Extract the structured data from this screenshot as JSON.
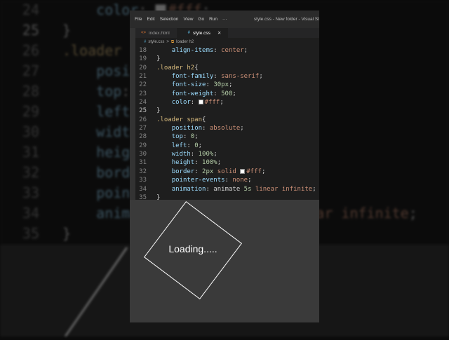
{
  "menu": [
    "File",
    "Edit",
    "Selection",
    "View",
    "Go",
    "Run",
    "···"
  ],
  "window_title": "style.css - New folder - Visual St",
  "tabs": [
    {
      "label": "index.html",
      "icon": "<>"
    },
    {
      "label": "style.css",
      "icon": "#",
      "close": "✕"
    }
  ],
  "breadcrumb": {
    "file": "style.css",
    "sep": ">",
    "symbol": "loader h2"
  },
  "code_lines": [
    {
      "n": "18",
      "parts": [
        [
          "t",
          "    "
        ],
        [
          "p",
          "align-items"
        ],
        [
          "t",
          ": "
        ],
        [
          "v",
          "center"
        ],
        [
          "t",
          ";"
        ]
      ]
    },
    {
      "n": "19",
      "parts": [
        [
          "t",
          "}"
        ]
      ]
    },
    {
      "n": "20",
      "parts": [
        [
          "s",
          ".loader h2"
        ],
        [
          "t",
          "{"
        ]
      ]
    },
    {
      "n": "21",
      "parts": [
        [
          "t",
          "    "
        ],
        [
          "p",
          "font-family"
        ],
        [
          "t",
          ": "
        ],
        [
          "v",
          "sans-serif"
        ],
        [
          "t",
          ";"
        ]
      ]
    },
    {
      "n": "22",
      "parts": [
        [
          "t",
          "    "
        ],
        [
          "p",
          "font-size"
        ],
        [
          "t",
          ": "
        ],
        [
          "n",
          "30px"
        ],
        [
          "t",
          ";"
        ]
      ]
    },
    {
      "n": "23",
      "parts": [
        [
          "t",
          "    "
        ],
        [
          "p",
          "font-weight"
        ],
        [
          "t",
          ": "
        ],
        [
          "n",
          "500"
        ],
        [
          "t",
          ";"
        ]
      ]
    },
    {
      "n": "24",
      "parts": [
        [
          "t",
          "    "
        ],
        [
          "p",
          "color"
        ],
        [
          "t",
          ": "
        ],
        [
          "sw",
          ""
        ],
        [
          "v",
          "#fff"
        ],
        [
          "t",
          ";"
        ]
      ]
    },
    {
      "n": "25",
      "parts": [
        [
          "t",
          "}"
        ]
      ],
      "current": true
    },
    {
      "n": "26",
      "parts": [
        [
          "s",
          ".loader span"
        ],
        [
          "t",
          "{"
        ]
      ]
    },
    {
      "n": "27",
      "parts": [
        [
          "t",
          "    "
        ],
        [
          "p",
          "position"
        ],
        [
          "t",
          ": "
        ],
        [
          "v",
          "absolute"
        ],
        [
          "t",
          ";"
        ]
      ]
    },
    {
      "n": "28",
      "parts": [
        [
          "t",
          "    "
        ],
        [
          "p",
          "top"
        ],
        [
          "t",
          ": "
        ],
        [
          "n",
          "0"
        ],
        [
          "t",
          ";"
        ]
      ]
    },
    {
      "n": "29",
      "parts": [
        [
          "t",
          "    "
        ],
        [
          "p",
          "left"
        ],
        [
          "t",
          ": "
        ],
        [
          "n",
          "0"
        ],
        [
          "t",
          ";"
        ]
      ]
    },
    {
      "n": "30",
      "parts": [
        [
          "t",
          "    "
        ],
        [
          "p",
          "width"
        ],
        [
          "t",
          ": "
        ],
        [
          "n",
          "100%"
        ],
        [
          "t",
          ";"
        ]
      ]
    },
    {
      "n": "31",
      "parts": [
        [
          "t",
          "    "
        ],
        [
          "p",
          "height"
        ],
        [
          "t",
          ": "
        ],
        [
          "n",
          "100%"
        ],
        [
          "t",
          ";"
        ]
      ]
    },
    {
      "n": "32",
      "parts": [
        [
          "t",
          "    "
        ],
        [
          "p",
          "border"
        ],
        [
          "t",
          ": "
        ],
        [
          "n",
          "2px"
        ],
        [
          "t",
          " "
        ],
        [
          "v",
          "solid"
        ],
        [
          "t",
          " "
        ],
        [
          "sw",
          ""
        ],
        [
          "v",
          "#fff"
        ],
        [
          "t",
          ";"
        ]
      ]
    },
    {
      "n": "33",
      "parts": [
        [
          "t",
          "    "
        ],
        [
          "p",
          "pointer-events"
        ],
        [
          "t",
          ": "
        ],
        [
          "v",
          "none"
        ],
        [
          "t",
          ";"
        ]
      ]
    },
    {
      "n": "34",
      "parts": [
        [
          "t",
          "    "
        ],
        [
          "p",
          "animation"
        ],
        [
          "t",
          ": animate "
        ],
        [
          "n",
          "5s"
        ],
        [
          "t",
          " "
        ],
        [
          "v",
          "linear infinite"
        ],
        [
          "t",
          ";"
        ]
      ]
    },
    {
      "n": "35",
      "parts": [
        [
          "t",
          "}"
        ]
      ]
    }
  ],
  "preview": {
    "text": "Loading....."
  }
}
